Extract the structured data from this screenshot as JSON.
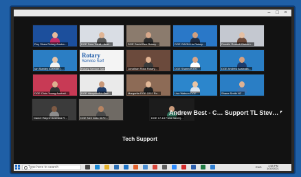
{
  "window": {
    "minimize_glyph": "–",
    "maximize_glyph": "□",
    "close_glyph": "×"
  },
  "tiles": [
    {
      "label": "Roy Shaw Rotary Austra…",
      "bg": "#1c4f9c",
      "skin": "#e5b99a",
      "shirt": "#c22f6a"
    },
    {
      "label": "DGE Sara Tolhill - Aust…",
      "bg": "#d9dde4",
      "skin": "#e0b595",
      "shirt": "#5a5a5a"
    },
    {
      "label": "DGE David Bee Rotary…",
      "bg": "#8b7b6d",
      "skin": "#d6a789",
      "shirt": "#2e2e2e"
    },
    {
      "label": "DGE GAVIN Ho Rotary…",
      "bg": "#2a78c8",
      "skin": "#cf9f80",
      "shirt": "#1e2e48"
    },
    {
      "label": "Rosalie Russell Gisborn…",
      "bg": "#c4c8d0",
      "skin": "#e4c0a4",
      "shirt": "#6d4a3a"
    },
    {
      "label": "Ian Stanley Australia (…",
      "bg": "#2b7ec4",
      "skin": "#e6c3a8",
      "shirt": "#f3f3f3"
    },
    {
      "label": "Rotary Service Self",
      "bg": "#f4f4f4",
      "skin": "#d9a98a",
      "shirt": "#2b4f8a"
    },
    {
      "label": "Jonathan Ross Rotary…",
      "bg": "#6b4a3c",
      "skin": "#e0b292",
      "shirt": "#3a3a3a"
    },
    {
      "label": "DGE Shannon-DG…",
      "bg": "#2b83c9",
      "skin": "#d8a588",
      "shirt": "#ffffff"
    },
    {
      "label": "DGE Andrew Australia…",
      "bg": "#2a7ec5",
      "skin": "#d4a081",
      "shirt": "#1d3d6e"
    },
    {
      "label": "DGE Chris Young Australi…",
      "bg": "#c83a55",
      "skin": "#ddb090",
      "shirt": "#333333"
    },
    {
      "label": "DGE Hiroyuki R.I. Dist…",
      "bg": "#eaeaea",
      "skin": "#c99878",
      "shirt": "#1f3d6a"
    },
    {
      "label": "Margarita DGE 2237 Ro…",
      "bg": "#8d6b56",
      "skin": "#e2b897",
      "shirt": "#202020"
    },
    {
      "label": "Lisa Watson DGE…",
      "bg": "#2c86cc",
      "skin": "#e8c4a4",
      "shirt": "#d9e4f0"
    },
    {
      "label": "Shane Smith NZ…",
      "bg": "#2a7ec5",
      "skin": "#dfb293",
      "shirt": "#3e79b8"
    },
    {
      "label": "Daniel Wayne Australia R…",
      "bg": "#3b3b3b",
      "skin": "#7e5a44",
      "shirt": "#8d8d8d"
    },
    {
      "label": "DGE Neil India 3170…",
      "bg": "#6f6a64",
      "skin": "#b78462",
      "shirt": "#4a4a4a"
    },
    {
      "label": "DGE 17-18 Faria Banerj…",
      "bg": "#1c1c1c",
      "skin": "#c99a7b",
      "shirt": "#2f6f5a"
    }
  ],
  "speakers": {
    "andrew": "Andrew Best - C…",
    "support": "Support TL Stev…",
    "tech": "Tech Support"
  },
  "taskbar": {
    "search_placeholder": "Type here to search",
    "lang": "ENG",
    "time": "1:58 PM",
    "date": "1/02/2021",
    "icons": [
      {
        "name": "task-view-icon",
        "color": "#444444"
      },
      {
        "name": "edge-icon",
        "color": "#1b8ad6"
      },
      {
        "name": "file-explorer-icon",
        "color": "#e6b12a"
      },
      {
        "name": "store-icon",
        "color": "#2b6fb6"
      },
      {
        "name": "mail-icon",
        "color": "#1d74c8"
      },
      {
        "name": "firefox-icon",
        "color": "#e2612b"
      },
      {
        "name": "photos-icon",
        "color": "#4a8fd4"
      },
      {
        "name": "chrome-icon",
        "color": "#d8463b"
      },
      {
        "name": "settings-icon",
        "color": "#5e5e5e"
      },
      {
        "name": "zoom-icon",
        "color": "#2d8cff"
      },
      {
        "name": "acrobat-icon",
        "color": "#d32b2b"
      },
      {
        "name": "word-icon",
        "color": "#2b5fad"
      },
      {
        "name": "excel-icon",
        "color": "#1f7a43"
      },
      {
        "name": "onedrive-icon",
        "color": "#2f7fd2"
      }
    ]
  }
}
